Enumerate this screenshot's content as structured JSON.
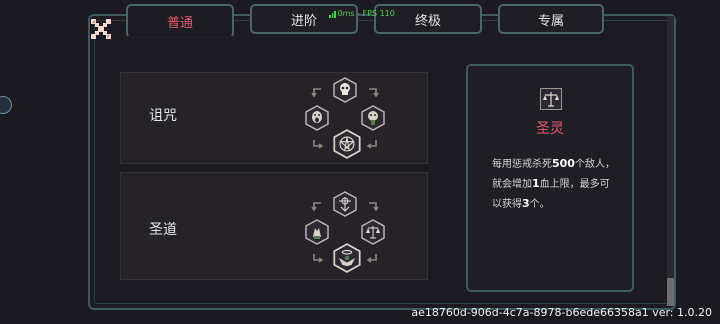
{
  "tabs": [
    {
      "label": "普通"
    },
    {
      "label": "进阶"
    },
    {
      "label": "终极"
    },
    {
      "label": "专属"
    }
  ],
  "fps_overlay": {
    "text": "0ms - FPS 110"
  },
  "cards": [
    {
      "name": "诅咒",
      "icons": [
        "skull-icon",
        "screaming-face-icon",
        "crying-face-icon",
        "pentagram-icon"
      ]
    },
    {
      "name": "圣道",
      "icons": [
        "holy-symbol-icon",
        "praying-hands-icon",
        "scales-icon",
        "angel-halo-icon"
      ]
    }
  ],
  "info_panel": {
    "icon": "scales-icon",
    "title": "圣灵",
    "desc_part1": "每用惩戒杀死",
    "desc_num1": "500",
    "desc_part2": "个敌人，就会增加",
    "desc_num2": "1",
    "desc_part3": "血上限，最多可以获得",
    "desc_num3": "3",
    "desc_part4": "个。"
  },
  "version": "ae18760d-906d-4c7a-8978-b6ede66358a1 ver: 1.0.20",
  "colors": {
    "active_tab": "#e55a6a",
    "border": "#3e5a5c",
    "fps": "#40d840"
  }
}
